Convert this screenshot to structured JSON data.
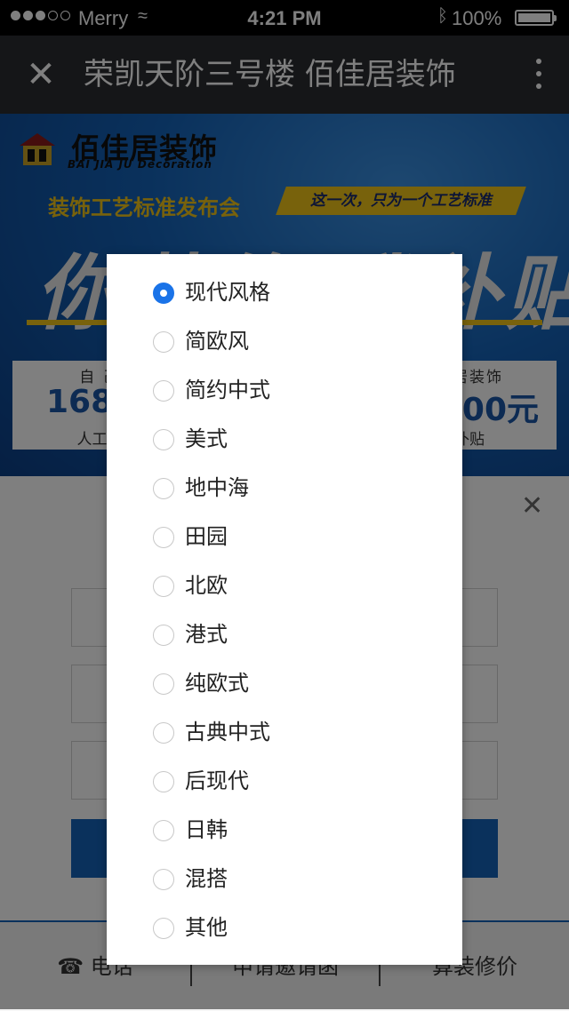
{
  "status_bar": {
    "carrier": "Merry",
    "time": "4:21 PM",
    "battery": "100%"
  },
  "nav": {
    "title": "荣凯天阶三号楼 佰佳居装饰"
  },
  "banner": {
    "logo_cn": "佰佳居装饰",
    "logo_en": "BAI JIA JU Decoration",
    "slogan_left": "装饰工艺标准发布会",
    "slogan_right": "这一次，只为一个工艺标准",
    "headline": "你装修 我补贴",
    "left_box": {
      "caption": "自 己",
      "number": "168",
      "footer": "人工花"
    },
    "right_box": {
      "caption": "佳居装饰",
      "number": "00元",
      "footer": "补贴"
    }
  },
  "bottom_bar": {
    "phone": "电话",
    "invite": "申请邀请函",
    "price": "算装修价"
  },
  "modal": {
    "options": [
      {
        "label": "现代风格",
        "checked": true
      },
      {
        "label": "简欧风",
        "checked": false
      },
      {
        "label": "简约中式",
        "checked": false
      },
      {
        "label": "美式",
        "checked": false
      },
      {
        "label": "地中海",
        "checked": false
      },
      {
        "label": "田园",
        "checked": false
      },
      {
        "label": "北欧",
        "checked": false
      },
      {
        "label": "港式",
        "checked": false
      },
      {
        "label": "纯欧式",
        "checked": false
      },
      {
        "label": "古典中式",
        "checked": false
      },
      {
        "label": "后现代",
        "checked": false
      },
      {
        "label": "日韩",
        "checked": false
      },
      {
        "label": "混搭",
        "checked": false
      },
      {
        "label": "其他",
        "checked": false
      }
    ]
  }
}
